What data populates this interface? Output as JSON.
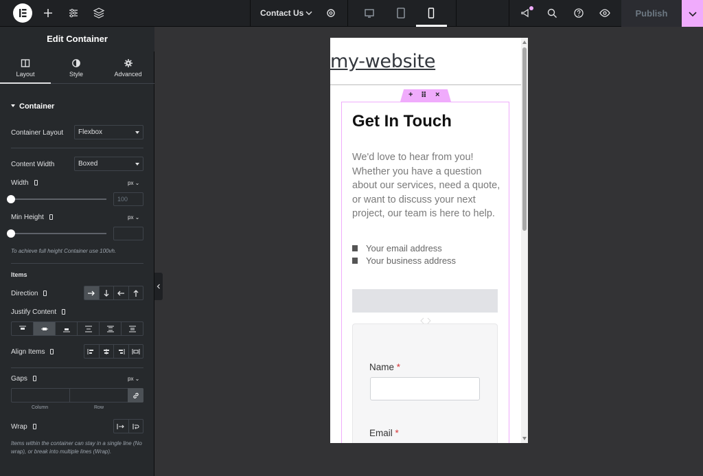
{
  "topbar": {
    "logo_icon": "elementor-logo-icon",
    "icons": [
      "add-element-icon",
      "site-settings-icon",
      "structure-icon"
    ],
    "page_name": "Contact Us",
    "page_settings_icon": "gear-icon",
    "devices": [
      "desktop-icon",
      "tablet-icon",
      "mobile-icon"
    ],
    "active_device": "mobile",
    "right_icons": [
      "whats-new-icon",
      "search-icon",
      "help-icon",
      "preview-eye-icon"
    ],
    "publish_label": "Publish",
    "accent": "#f0abfc"
  },
  "panel": {
    "title": "Edit Container",
    "tabs": [
      {
        "label": "Layout",
        "icon": "layout-icon"
      },
      {
        "label": "Style",
        "icon": "contrast-icon"
      },
      {
        "label": "Advanced",
        "icon": "gear-icon"
      }
    ],
    "active_tab": "Layout",
    "section": "Container",
    "container_layout": {
      "label": "Container Layout",
      "value": "Flexbox"
    },
    "content_width": {
      "label": "Content Width",
      "value": "Boxed"
    },
    "width": {
      "label": "Width",
      "unit": "px",
      "placeholder": "100",
      "slider_value": 0
    },
    "min_height": {
      "label": "Min Height",
      "unit": "px",
      "placeholder": "",
      "slider_value": 0
    },
    "min_height_hint": "To achieve full height Container use 100vh.",
    "items_heading": "Items",
    "direction": {
      "label": "Direction",
      "options": [
        "row",
        "column",
        "row-reverse",
        "column-reverse"
      ],
      "selected": "row"
    },
    "justify_content": {
      "label": "Justify Content",
      "options": [
        "start",
        "center",
        "end",
        "space-between",
        "space-around",
        "space-evenly"
      ],
      "selected": "center"
    },
    "align_items": {
      "label": "Align Items",
      "options": [
        "start",
        "center",
        "end",
        "stretch"
      ]
    },
    "gaps": {
      "label": "Gaps",
      "unit": "px",
      "column_caption": "Column",
      "row_caption": "Row",
      "link_icon": "link-icon"
    },
    "wrap": {
      "label": "Wrap",
      "options": [
        "no-wrap",
        "wrap"
      ]
    },
    "wrap_hint": "Items within the container can stay in a single line (No wrap), or break into multiple lines (Wrap)."
  },
  "preview": {
    "site_title": "my-website",
    "heading": "Get In Touch",
    "paragraph": "We'd love to hear from you! Whether you have a question about our services, need a quote, or want to discuss your next project, our team is here to help.",
    "email_line": "Your email address",
    "address_line": "Your business address",
    "form_name_label": "Name",
    "form_email_label": "Email",
    "required_mark": "*",
    "handle_icons": [
      "plus",
      "drag",
      "close"
    ]
  }
}
